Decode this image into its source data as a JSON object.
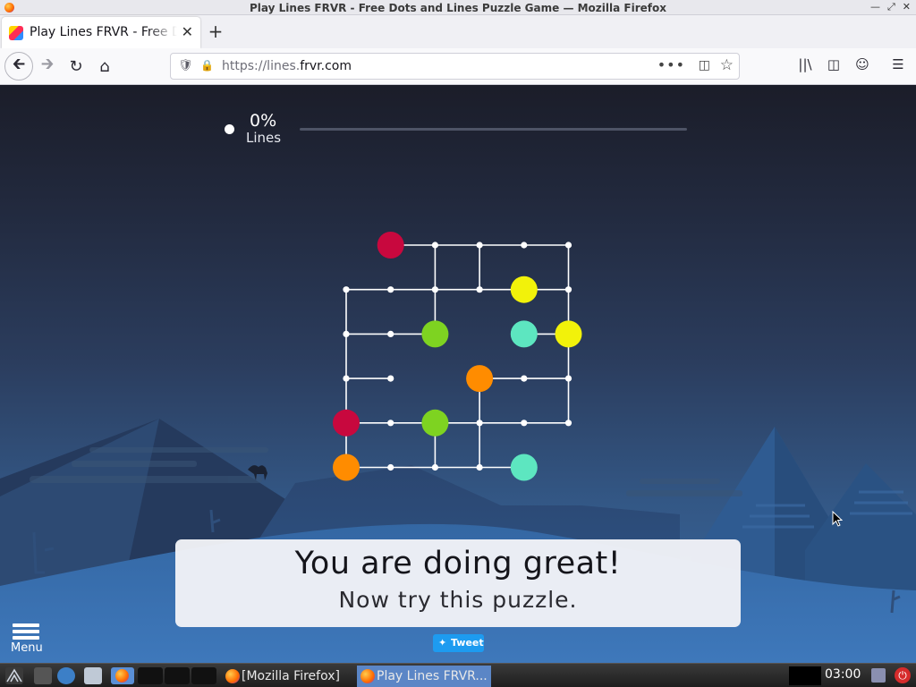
{
  "window": {
    "title": "Play Lines FRVR - Free Dots and Lines Puzzle Game — Mozilla Firefox"
  },
  "tabs": [
    {
      "label": "Play Lines FRVR - Free Dots and Lines Puzzle Game",
      "active": true
    }
  ],
  "navbar": {
    "url_prefix": "https://lines.",
    "url_domain": "frvr.com",
    "more_label": "•••"
  },
  "game": {
    "progress": {
      "percent_label": "0%",
      "label": "Lines",
      "fraction": 0
    },
    "colors": {
      "red": "#c8083e",
      "yellow": "#f2f20a",
      "green": "#7ed321",
      "teal": "#5de6c0",
      "orange": "#ff8c00",
      "line": "#ffffff"
    },
    "puzzle": {
      "columns": 6,
      "rows": 6,
      "edges": [
        [
          [
            1,
            0
          ],
          [
            5,
            0
          ]
        ],
        [
          [
            5,
            0
          ],
          [
            5,
            4
          ]
        ],
        [
          [
            2,
            0
          ],
          [
            2,
            2
          ]
        ],
        [
          [
            3,
            0
          ],
          [
            3,
            1
          ]
        ],
        [
          [
            0,
            1
          ],
          [
            5,
            1
          ]
        ],
        [
          [
            0,
            1
          ],
          [
            0,
            5
          ]
        ],
        [
          [
            0,
            2
          ],
          [
            2,
            2
          ]
        ],
        [
          [
            0,
            3
          ],
          [
            1,
            3
          ]
        ],
        [
          [
            3,
            3
          ],
          [
            5,
            3
          ]
        ],
        [
          [
            0,
            4
          ],
          [
            5,
            4
          ]
        ],
        [
          [
            3,
            3
          ],
          [
            3,
            5
          ]
        ],
        [
          [
            2,
            4
          ],
          [
            2,
            5
          ]
        ],
        [
          [
            0,
            5
          ],
          [
            4,
            5
          ]
        ],
        [
          [
            4,
            2
          ],
          [
            5,
            2
          ]
        ]
      ],
      "nodes": [
        [
          2,
          0
        ],
        [
          3,
          0
        ],
        [
          4,
          0
        ],
        [
          5,
          0
        ],
        [
          0,
          1
        ],
        [
          1,
          1
        ],
        [
          2,
          1
        ],
        [
          3,
          1
        ],
        [
          5,
          1
        ],
        [
          0,
          2
        ],
        [
          1,
          2
        ],
        [
          0,
          3
        ],
        [
          1,
          3
        ],
        [
          4,
          3
        ],
        [
          5,
          3
        ],
        [
          1,
          4
        ],
        [
          3,
          4
        ],
        [
          4,
          4
        ],
        [
          5,
          4
        ],
        [
          1,
          5
        ],
        [
          2,
          5
        ],
        [
          3,
          5
        ]
      ],
      "endpoints": [
        {
          "color": "red",
          "cell": [
            1,
            0
          ]
        },
        {
          "color": "yellow",
          "cell": [
            4,
            1
          ]
        },
        {
          "color": "green",
          "cell": [
            2,
            2
          ]
        },
        {
          "color": "teal",
          "cell": [
            4,
            2
          ]
        },
        {
          "color": "yellow",
          "cell": [
            5,
            2
          ]
        },
        {
          "color": "orange",
          "cell": [
            3,
            3
          ]
        },
        {
          "color": "red",
          "cell": [
            0,
            4
          ]
        },
        {
          "color": "green",
          "cell": [
            2,
            4
          ]
        },
        {
          "color": "orange",
          "cell": [
            0,
            5
          ]
        },
        {
          "color": "teal",
          "cell": [
            4,
            5
          ]
        }
      ]
    },
    "message": {
      "title": "You are doing great!",
      "subtitle": "Now try this puzzle."
    },
    "menu_label": "Menu",
    "tweet_label": "Tweet"
  },
  "taskbar": {
    "windows": [
      {
        "label": "[Mozilla Firefox]",
        "active": false
      },
      {
        "label": "Play Lines FRVR...",
        "active": true
      }
    ],
    "clock": "03:00"
  }
}
